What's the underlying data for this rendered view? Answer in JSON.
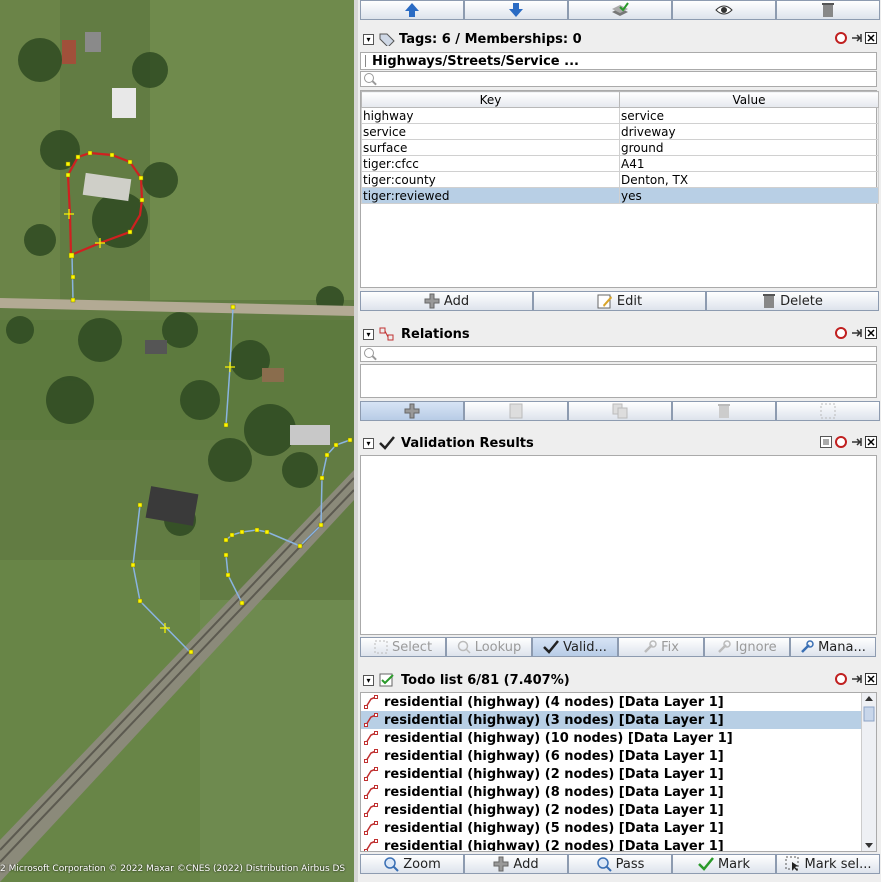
{
  "map": {
    "attribution": "2 Microsoft Corporation © 2022 Maxar ©CNES (2022) Distribution Airbus DS"
  },
  "top_buttons": [
    {
      "name": "up-arrow-icon"
    },
    {
      "name": "down-arrow-icon"
    },
    {
      "name": "layers-check-icon"
    },
    {
      "name": "eye-icon"
    },
    {
      "name": "trash-icon"
    }
  ],
  "tags_panel": {
    "title": "Tags: 6 / Memberships: 0",
    "preset": "Highways/Streets/Service ...",
    "search_placeholder": "",
    "columns": {
      "key": "Key",
      "value": "Value"
    },
    "rows": [
      {
        "key": "highway",
        "value": "service"
      },
      {
        "key": "service",
        "value": "driveway"
      },
      {
        "key": "surface",
        "value": "ground"
      },
      {
        "key": "tiger:cfcc",
        "value": "A41"
      },
      {
        "key": "tiger:county",
        "value": "Denton, TX"
      },
      {
        "key": "tiger:reviewed",
        "value": "yes"
      }
    ],
    "selected_row": 5,
    "buttons": {
      "add": "Add",
      "edit": "Edit",
      "delete": "Delete"
    }
  },
  "relations_panel": {
    "title": "Relations"
  },
  "validation_panel": {
    "title": "Validation Results",
    "buttons": {
      "select": "Select",
      "lookup": "Lookup",
      "validate": "Valid...",
      "fix": "Fix",
      "ignore": "Ignore",
      "manage": "Mana..."
    }
  },
  "todo_panel": {
    "title": "Todo list 6/81 (7.407%)",
    "items": [
      "residential (highway) (4 nodes) [Data Layer 1]",
      "residential (highway) (3 nodes) [Data Layer 1]",
      "residential (highway) (10 nodes) [Data Layer 1]",
      "residential (highway) (6 nodes) [Data Layer 1]",
      "residential (highway) (2 nodes) [Data Layer 1]",
      "residential (highway) (8 nodes) [Data Layer 1]",
      "residential (highway) (2 nodes) [Data Layer 1]",
      "residential (highway) (5 nodes) [Data Layer 1]",
      "residential (highway) (2 nodes) [Data Layer 1]"
    ],
    "selected_item": 1,
    "buttons": {
      "zoom": "Zoom",
      "add": "Add",
      "pass": "Pass",
      "mark": "Mark",
      "mark_selected": "Mark sel..."
    }
  }
}
